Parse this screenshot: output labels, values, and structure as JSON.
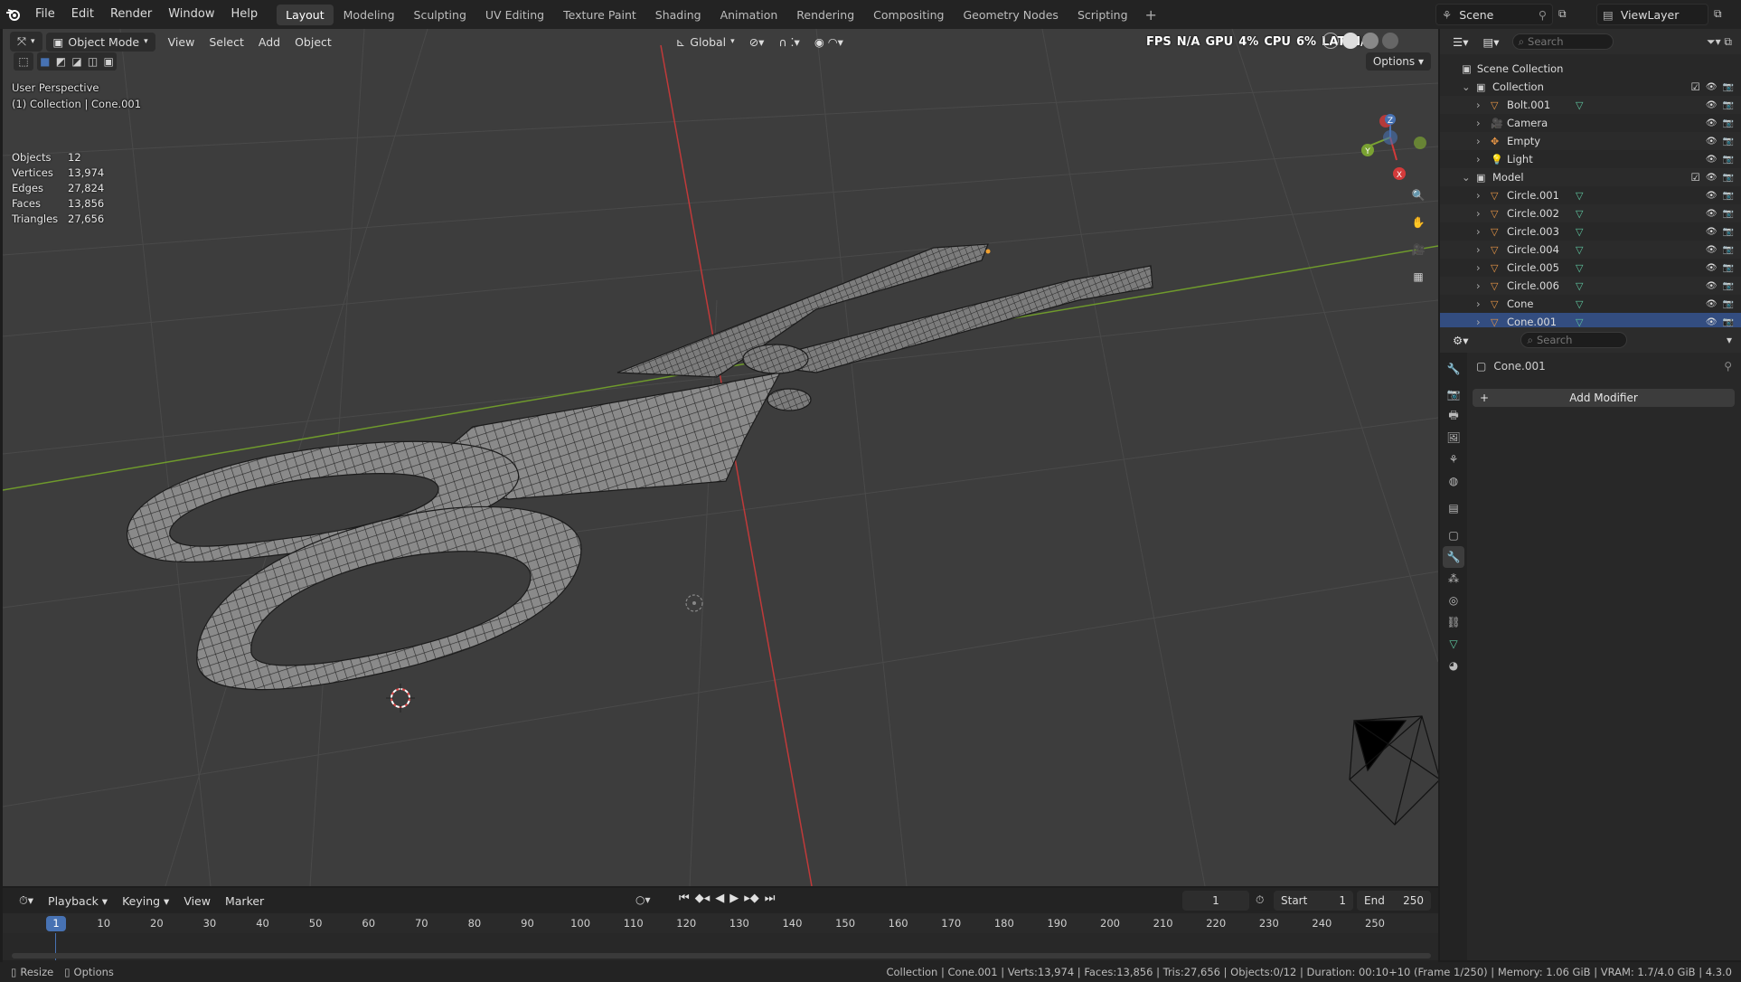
{
  "app": {
    "menus": [
      "File",
      "Edit",
      "Render",
      "Window",
      "Help"
    ],
    "workspaces": [
      "Layout",
      "Modeling",
      "Sculpting",
      "UV Editing",
      "Texture Paint",
      "Shading",
      "Animation",
      "Rendering",
      "Compositing",
      "Geometry Nodes",
      "Scripting"
    ],
    "active_workspace": "Layout",
    "scene": "Scene",
    "view_layer": "ViewLayer"
  },
  "viewport": {
    "mode": "Object Mode",
    "menus": [
      "View",
      "Select",
      "Add",
      "Object"
    ],
    "transform_orientation": "Global",
    "options_label": "Options",
    "view_name": "User Perspective",
    "context": "(1) Collection | Cone.001",
    "overlay_readout": {
      "fps_label": "FPS",
      "fps_value": "N/A",
      "gpu_label": "GPU",
      "gpu_value": "4%",
      "cpu_label": "CPU",
      "cpu_value": "6%",
      "lat_label": "LAT",
      "lat_value": "N/A"
    },
    "stats": [
      {
        "label": "Objects",
        "value": "12"
      },
      {
        "label": "Vertices",
        "value": "13,974"
      },
      {
        "label": "Edges",
        "value": "27,824"
      },
      {
        "label": "Faces",
        "value": "13,856"
      },
      {
        "label": "Triangles",
        "value": "27,656"
      }
    ],
    "gizmo_axes": {
      "x": "X",
      "y": "Y",
      "z": "Z"
    }
  },
  "timeline": {
    "menus": [
      "Playback",
      "Keying",
      "View",
      "Marker"
    ],
    "current_frame": "1",
    "start_label": "Start",
    "start": "1",
    "end_label": "End",
    "end": "250",
    "ticks": [
      "10",
      "20",
      "30",
      "40",
      "50",
      "60",
      "70",
      "80",
      "90",
      "100",
      "110",
      "120",
      "130",
      "140",
      "150",
      "160",
      "170",
      "180",
      "190",
      "200",
      "210",
      "220",
      "230",
      "240",
      "250"
    ]
  },
  "outliner": {
    "search_placeholder": "Search",
    "root": "Scene Collection",
    "rows": [
      {
        "name": "Collection",
        "type": "collection",
        "depth": 1
      },
      {
        "name": "Bolt.001",
        "type": "mesh",
        "depth": 2
      },
      {
        "name": "Camera",
        "type": "camera",
        "depth": 2
      },
      {
        "name": "Empty",
        "type": "empty",
        "depth": 2
      },
      {
        "name": "Light",
        "type": "light",
        "depth": 2
      },
      {
        "name": "Model",
        "type": "collection",
        "depth": 1
      },
      {
        "name": "Circle.001",
        "type": "mesh",
        "depth": 2
      },
      {
        "name": "Circle.002",
        "type": "mesh",
        "depth": 2
      },
      {
        "name": "Circle.003",
        "type": "mesh",
        "depth": 2
      },
      {
        "name": "Circle.004",
        "type": "mesh",
        "depth": 2
      },
      {
        "name": "Circle.005",
        "type": "mesh",
        "depth": 2
      },
      {
        "name": "Circle.006",
        "type": "mesh",
        "depth": 2
      },
      {
        "name": "Cone",
        "type": "mesh",
        "depth": 2
      },
      {
        "name": "Cone.001",
        "type": "mesh",
        "depth": 2,
        "selected": true
      }
    ]
  },
  "properties": {
    "search_placeholder": "Search",
    "object_name": "Cone.001",
    "add_modifier_label": "Add Modifier"
  },
  "statusbar": {
    "left_items": [
      "Resize",
      "Options"
    ],
    "info": "Collection | Cone.001 | Verts:13,974 | Faces:13,856 | Tris:27,656 | Objects:0/12 | Duration: 00:10+10 (Frame 1/250) | Memory: 1.06 GiB | VRAM: 1.7/4.0 GiB | 4.3.0"
  },
  "colors": {
    "accent": "#4772b3",
    "x_axis": "#d33a3a",
    "y_axis": "#7aa232",
    "mesh_icon": "#e89646",
    "mesh_data": "#5fc7a0"
  }
}
